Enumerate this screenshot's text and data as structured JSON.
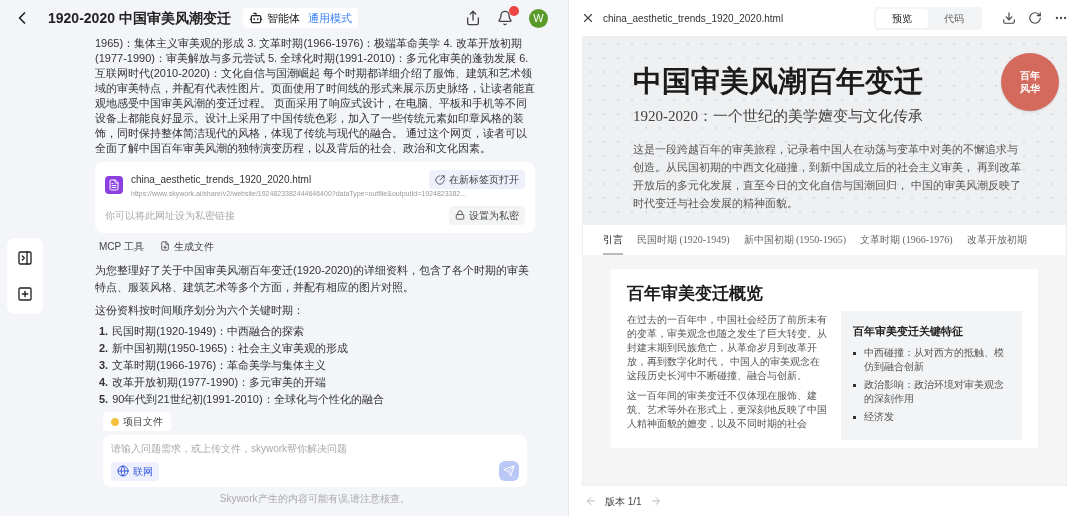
{
  "header": {
    "title": "1920-2020 中国审美风潮变迁",
    "agent_label": "智能体",
    "mode_label": "通用模式",
    "avatar": "W"
  },
  "chat": {
    "summary": "1965)：集体主义审美观的形成 3. 文革时期(1966-1976)：极端革命美学 4. 改革开放初期(1977-1990)：审美解放与多元尝试 5. 全球化时期(1991-2010)：多元化审美的蓬勃发展 6. 互联网时代(2010-2020)：文化自信与国潮崛起 每个时期都详细介绍了服饰、建筑和艺术领域的审美特点，并配有代表性图片。页面使用了时间线的形式来展示历史脉络，让读者能直观地感受中国审美风潮的变迁过程。 页面采用了响应式设计，在电脑、平板和手机等不同设备上都能良好显示。设计上采用了中国传统色彩，加入了一些传统元素如印章风格的装饰，同时保持整体简洁现代的风格，体现了传统与现代的融合。 通过这个网页，读者可以全面了解中国百年审美风潮的独特演变历程，以及背后的社会、政治和文化因素。",
    "file_card": {
      "name": "china_aesthetic_trends_1920_2020.html",
      "url": "https://www.skywork.ai/share/v2/website/1924823382444646400?dataType=outfile&outputId=1924823382...",
      "open_label": "在新标签页打开",
      "hint": "你可以将此网址设为私密链接",
      "private_label": "设置为私密"
    },
    "tools": [
      {
        "kind": "mcp",
        "label": "MCP 工具"
      },
      {
        "kind": "file",
        "label": "生成文件"
      }
    ],
    "intro": "为您整理好了关于中国审美风潮百年变迁(1920-2020)的详细资料，包含了各个时期的审美特点、服装风格、建筑艺术等多个方面，并配有相应的图片对照。",
    "list_intro": "这份资料按时间顺序划分为六个关键时期：",
    "periods": [
      {
        "num": "1.",
        "text": "民国时期(1920-1949)：中西融合的探索"
      },
      {
        "num": "2.",
        "text": "新中国初期(1950-1965)：社会主义审美观的形成"
      },
      {
        "num": "3.",
        "text": "文革时期(1966-1976)：革命美学与集体主义"
      },
      {
        "num": "4.",
        "text": "改革开放初期(1977-1990)：多元审美的开端"
      },
      {
        "num": "5.",
        "text": "90年代到21世纪初(1991-2010)：全球化与个性化的融合"
      }
    ],
    "project_files": "项目文件",
    "input": {
      "placeholder": "请输入问题需求，或上传文件，skywork帮你解决问题",
      "web_label": "联网"
    },
    "disclaimer": "Skywork产生的内容可能有误,请注意核查。"
  },
  "preview": {
    "filename": "china_aesthetic_trends_1920_2020.html",
    "view_tabs": [
      {
        "label": "预览",
        "selected": true
      },
      {
        "label": "代码",
        "selected": false
      }
    ],
    "hero": {
      "title": "中国审美风潮百年变迁",
      "subtitle": "1920-2020：一个世纪的美学嬗变与文化传承",
      "text": "这是一段跨越百年的审美旅程，记录着中国人在动荡与变革中对美的不懈追求与创造。从民国初期的中西文化碰撞，到新中国成立后的社会主义审美， 再到改革开放后的多元化发展，直至今日的文化自信与国潮回归， 中国的审美风潮反映了时代变迁与社会发展的精神面貌。",
      "seal": "百年风华"
    },
    "nav": [
      {
        "label": "引言",
        "selected": true
      },
      {
        "label": "民国时期 (1920-1949)",
        "selected": false
      },
      {
        "label": "新中国初期 (1950-1965)",
        "selected": false
      },
      {
        "label": "文革时期 (1966-1976)",
        "selected": false
      },
      {
        "label": "改革开放初期",
        "selected": false
      }
    ],
    "section": {
      "title": "百年审美变迁概览",
      "paragraphs": [
        "在过去的一百年中，中国社会经历了前所未有的变革，审美观念也随之发生了巨大转变。从封建末期到民族危亡，从革命岁月到改革开放，再到数字化时代， 中国人的审美观念在这段历史长河中不断碰撞、融合与创新。",
        "这一百年间的审美变迁不仅体现在服饰、建筑、艺术等外在形式上，更深刻地反映了中国人精神面貌的嬗变，以及不同时期的社会"
      ],
      "box_title": "百年审美变迁关键特征",
      "features": [
        "中西碰撞：从对西方的抵触、模仿到融合创新",
        "政治影响：政治环境对审美观念的深刻作用",
        "经济发"
      ]
    },
    "version": "版本 1/1"
  }
}
